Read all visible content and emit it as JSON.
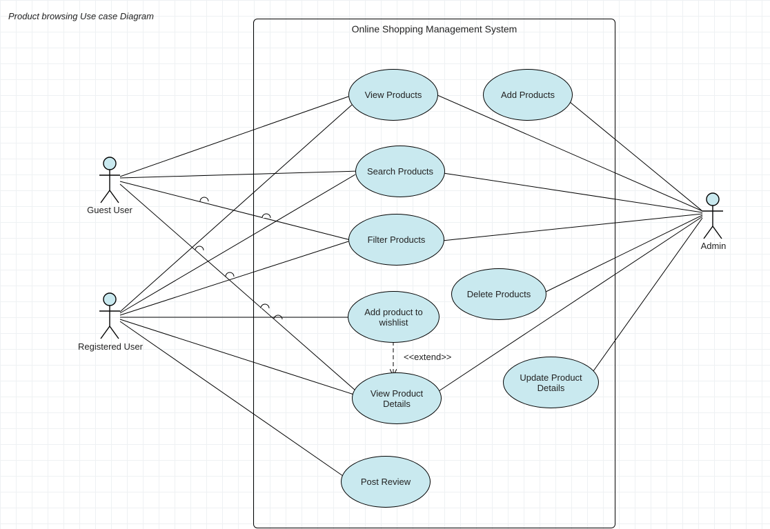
{
  "diagram_title": "Product browsing Use case Diagram",
  "system_name": "Online Shopping Management System",
  "actors": {
    "guest": "Guest User",
    "registered": "Registered User",
    "admin": "Admin"
  },
  "use_cases": {
    "view_products": "View Products",
    "search_products": "Search Products",
    "filter_products": "Filter Products",
    "add_wishlist": "Add product to wishlist",
    "view_details": "View Product Details",
    "post_review": "Post Review",
    "add_products": "Add Products",
    "delete_products": "Delete Products",
    "update_details": "Update Product Details"
  },
  "relationships": {
    "extend_label": "<<extend>>"
  }
}
